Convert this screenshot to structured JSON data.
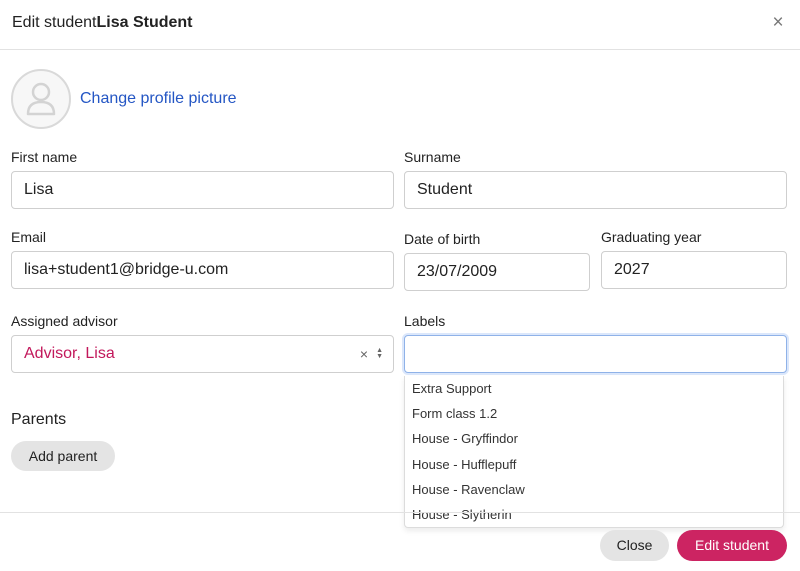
{
  "header": {
    "title_prefix": "Edit student",
    "title_name": "Lisa Student",
    "close_icon": "×"
  },
  "profile": {
    "avatar_icon": "user-silhouette-icon",
    "change_picture_label": "Change profile picture"
  },
  "form": {
    "first_name": {
      "label": "First name",
      "value": "Lisa"
    },
    "surname": {
      "label": "Surname",
      "value": "Student"
    },
    "email": {
      "label": "Email",
      "value": "lisa+student1@bridge-u.com"
    },
    "date_of_birth": {
      "label": "Date of birth",
      "value": "23/07/2009"
    },
    "graduating_year": {
      "label": "Graduating year",
      "value": "2027"
    },
    "assigned_advisor": {
      "label": "Assigned advisor",
      "value": "Advisor, Lisa",
      "clear_icon": "×"
    },
    "labels": {
      "label": "Labels",
      "value": "",
      "options": [
        "Extra Support",
        "Form class 1.2",
        "House - Gryffindor",
        "House - Hufflepuff",
        "House - Ravenclaw",
        "House - Slytherin"
      ]
    }
  },
  "parents": {
    "title": "Parents",
    "add_label": "Add parent"
  },
  "footer": {
    "close_label": "Close",
    "submit_label": "Edit student"
  },
  "colors": {
    "accent": "#cc2462",
    "link": "#2456c4",
    "advisor_text": "#c2185b",
    "focus_border": "#8fb2e8"
  }
}
